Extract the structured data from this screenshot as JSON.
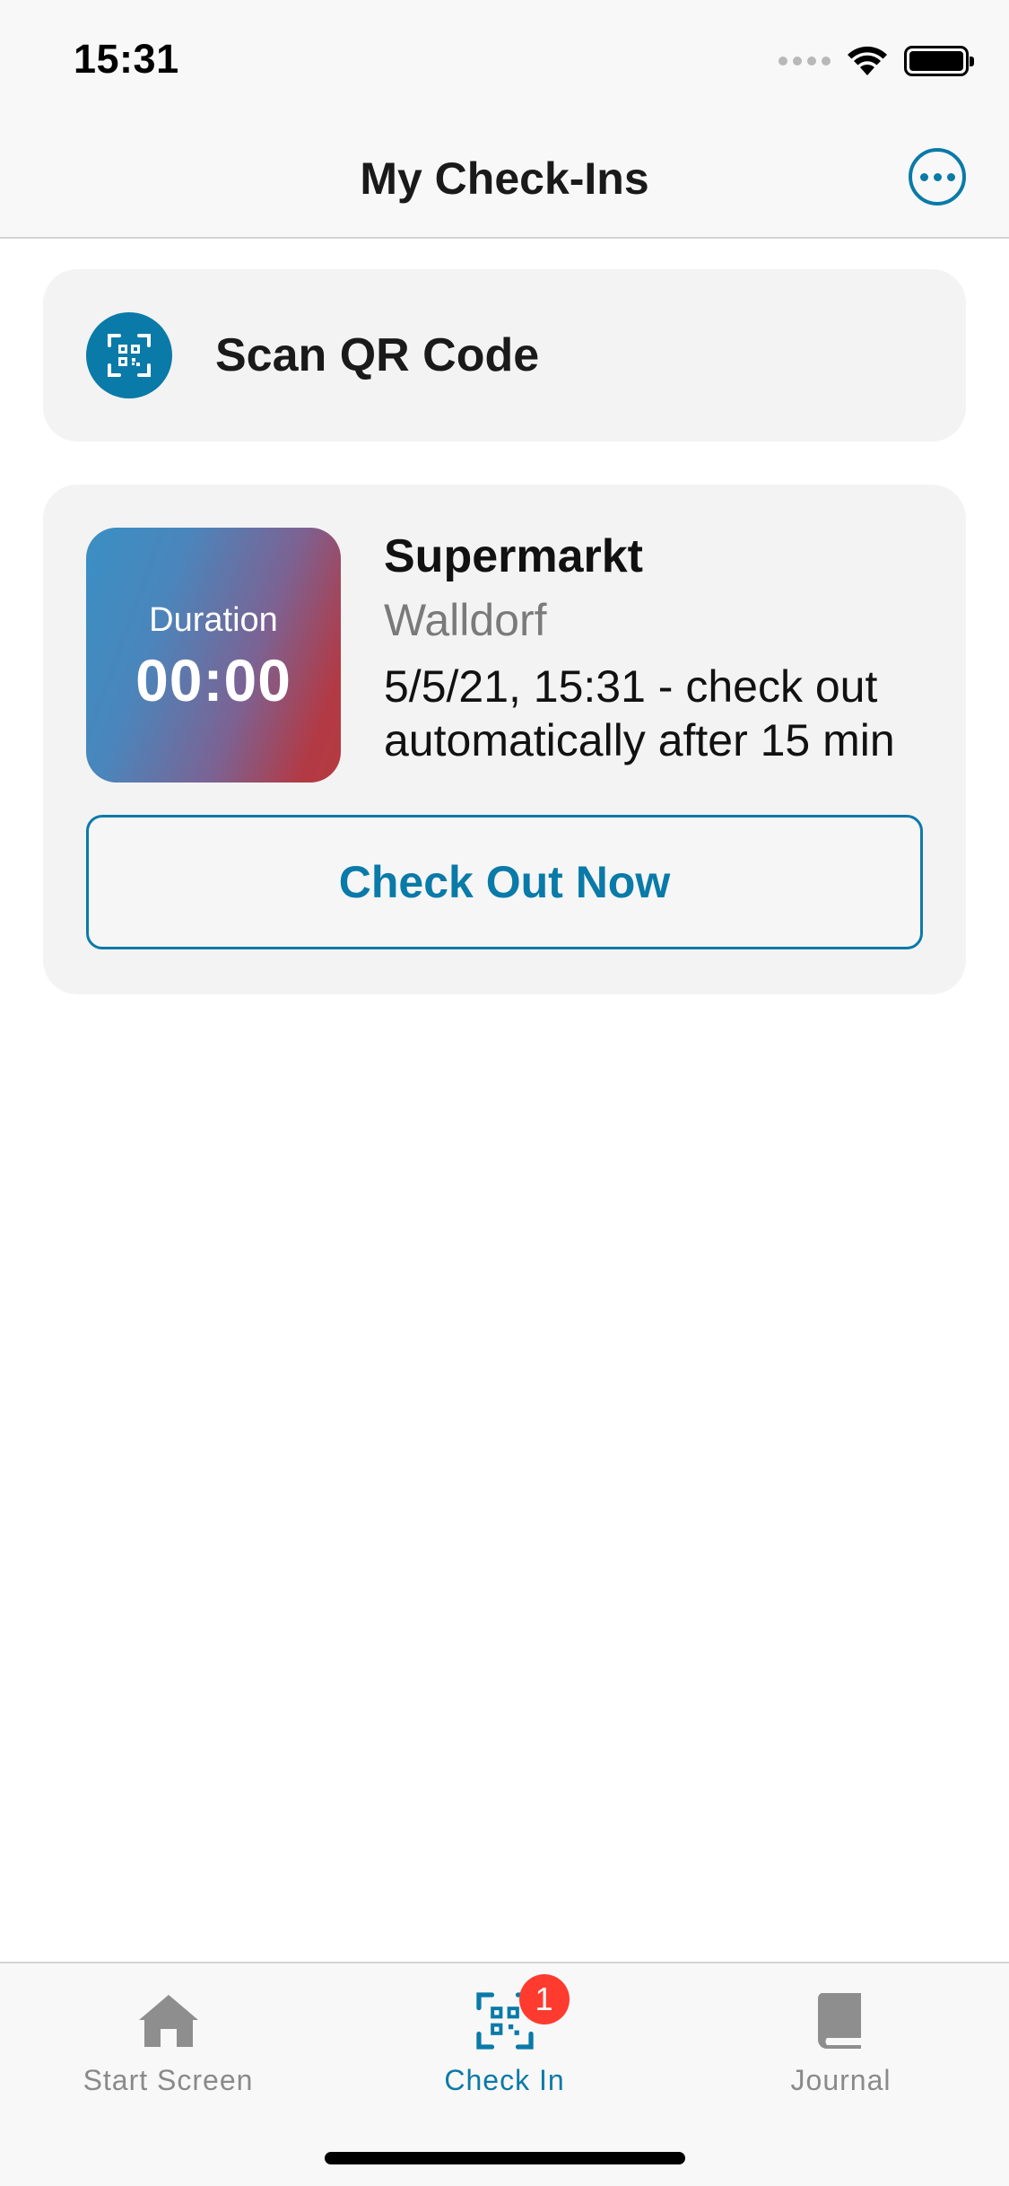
{
  "status_bar": {
    "time": "15:31",
    "icons": [
      "cellular-signal-icon",
      "wifi-icon",
      "battery-icon"
    ]
  },
  "nav": {
    "title": "My Check-Ins",
    "more_icon": "ellipsis-circle-icon"
  },
  "scan_card": {
    "label": "Scan QR Code",
    "icon": "qr-code-scan-icon"
  },
  "checkin": {
    "duration_label": "Duration",
    "duration_value": "00:00",
    "location_name": "Supermarkt",
    "location_city": "Walldorf",
    "info": "5/5/21, 15:31 - check out automatically after 15 min",
    "checkout_label": "Check Out Now"
  },
  "tabs": [
    {
      "label": "Start Screen",
      "icon": "house-icon",
      "active": false
    },
    {
      "label": "Check In",
      "icon": "qr-code-scan-icon",
      "active": true,
      "badge": "1"
    },
    {
      "label": "Journal",
      "icon": "book-icon",
      "active": false
    }
  ],
  "colors": {
    "accent": "#0a7aa8",
    "badge": "#ff3b30",
    "card_background": "#f3f3f3",
    "duration_gradient_start": "#3a8fc4",
    "duration_gradient_end": "#b63a40"
  }
}
